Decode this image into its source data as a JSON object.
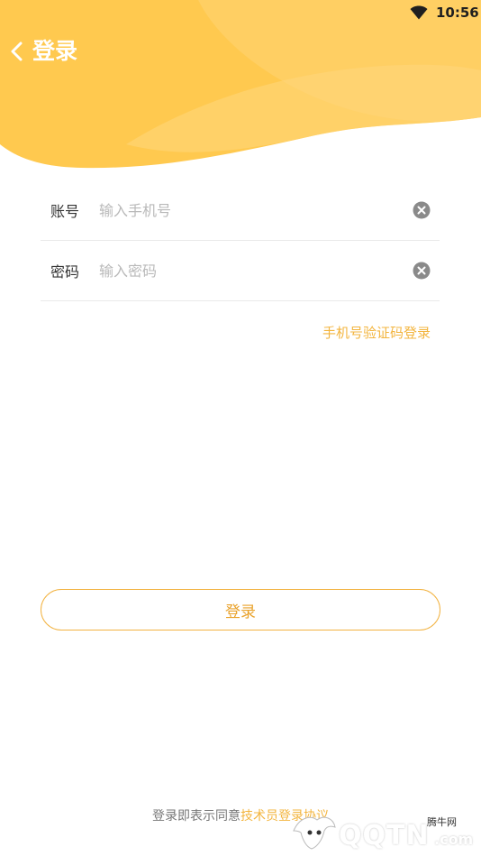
{
  "status_bar": {
    "time": "10:56",
    "wifi_icon": "wifi-icon"
  },
  "header": {
    "back_icon": "chevron-left-icon",
    "title": "登录",
    "bg_color": "#ffc94f"
  },
  "form": {
    "account": {
      "label": "账号",
      "placeholder": "输入手机号",
      "value": "",
      "clear_icon": "clear-icon"
    },
    "password": {
      "label": "密码",
      "placeholder": "输入密码",
      "value": "",
      "clear_icon": "clear-icon"
    }
  },
  "sms_login_link": "手机号验证码登录",
  "login_button": "登录",
  "agreement": {
    "prefix": "登录即表示同意",
    "link": "技术员登录协议"
  },
  "watermark": {
    "brand": "QQTN",
    "suffix": ".com",
    "cn": "腾牛网"
  },
  "colors": {
    "accent": "#f3b53f",
    "header": "#ffc94f",
    "button_border": "#f2b342"
  }
}
